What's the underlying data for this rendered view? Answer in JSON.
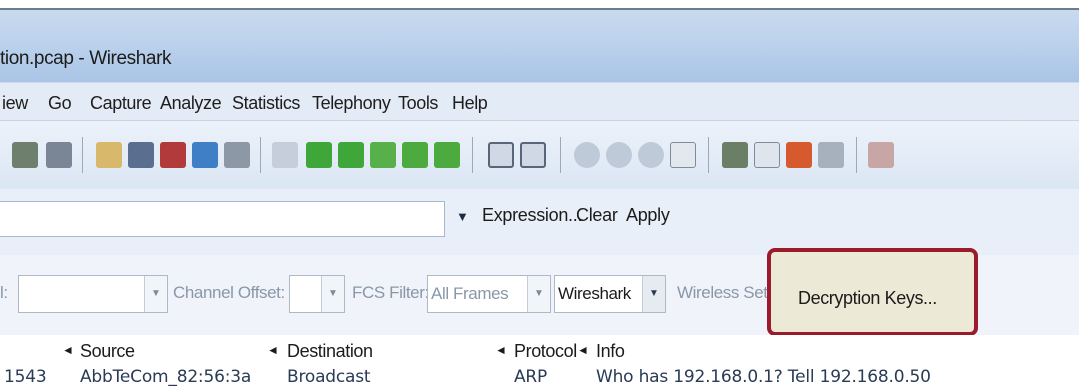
{
  "window": {
    "title": "tion.pcap - Wireshark"
  },
  "menu": {
    "items": [
      "iew",
      "Go",
      "Capture",
      "Analyze",
      "Statistics",
      "Telephony",
      "Tools",
      "Help"
    ]
  },
  "toolbar": {
    "icons": [
      "interface-list-icon",
      "capture-options-icon",
      "open-file-icon",
      "save-file-icon",
      "close-file-icon",
      "reload-icon",
      "print-icon",
      "find-packet-icon",
      "go-back-icon",
      "go-forward-icon",
      "go-to-packet-icon",
      "go-first-icon",
      "go-last-icon",
      "colorize-icon",
      "autoscroll-icon",
      "zoom-in-icon",
      "zoom-out-icon",
      "zoom-normal-icon",
      "resize-columns-icon",
      "capture-filters-icon",
      "display-filters-icon",
      "coloring-rules-icon",
      "preferences-icon",
      "help-icon"
    ],
    "colors": {
      "accent_green": "#3fa73a",
      "accent_blue": "#2c6fb7"
    }
  },
  "filter": {
    "value": "",
    "expression_label": "Expression...",
    "clear_label": "Clear",
    "apply_label": "Apply"
  },
  "wireless": {
    "prefix_label": "l:",
    "channel_offset_label": "Channel Offset:",
    "fcs_filter_label": "FCS Filter:",
    "fcs_filter_value": "All Frames",
    "decryption_mode_value": "Wireshark",
    "wireless_settings_label": "Wireless Settin...",
    "decryption_keys_label": "Decryption Keys...",
    "highlight_color": "#9b1b2c"
  },
  "packet_list": {
    "columns": [
      "Source",
      "Destination",
      "Protocol",
      "Info"
    ],
    "partial_row": {
      "no": "1543",
      "source": "AbbTeCom_82:56:3a",
      "destination": "Broadcast",
      "protocol": "ARP",
      "info": "Who has 192.168.0.1? Tell 192.168.0.50"
    }
  }
}
